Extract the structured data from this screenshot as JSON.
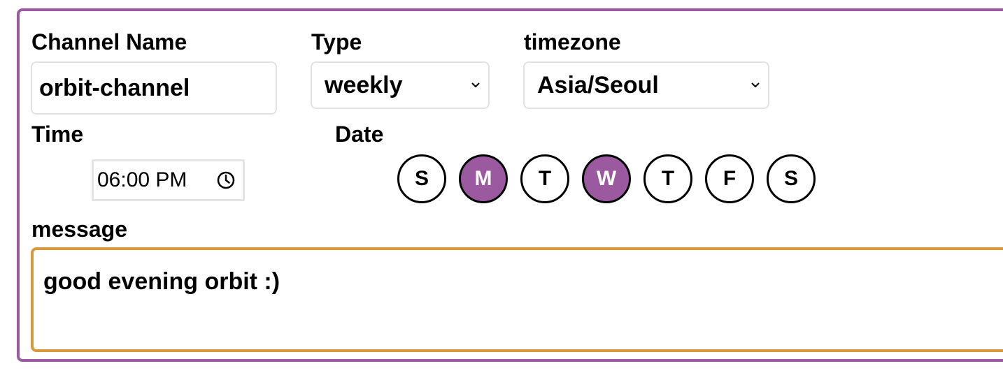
{
  "form": {
    "channel_name_label": "Channel Name",
    "channel_name_value": "orbit-channel",
    "type_label": "Type",
    "type_value": "weekly",
    "timezone_label": "timezone",
    "timezone_value": "Asia/Seoul",
    "time_label": "Time",
    "time_value": "06:00 PM",
    "date_label": "Date",
    "days": [
      {
        "label": "S",
        "selected": false
      },
      {
        "label": "M",
        "selected": true
      },
      {
        "label": "T",
        "selected": false
      },
      {
        "label": "W",
        "selected": true
      },
      {
        "label": "T",
        "selected": false
      },
      {
        "label": "F",
        "selected": false
      },
      {
        "label": "S",
        "selected": false
      }
    ],
    "message_label": "message",
    "message_value": "good evening orbit :)"
  },
  "colors": {
    "accent_purple": "#9b5a9f",
    "message_border": "#d69a3c",
    "input_border": "#e1e1e1"
  },
  "icons": {
    "select_chevron": "chevron-down-icon",
    "time_picker": "clock-icon"
  }
}
